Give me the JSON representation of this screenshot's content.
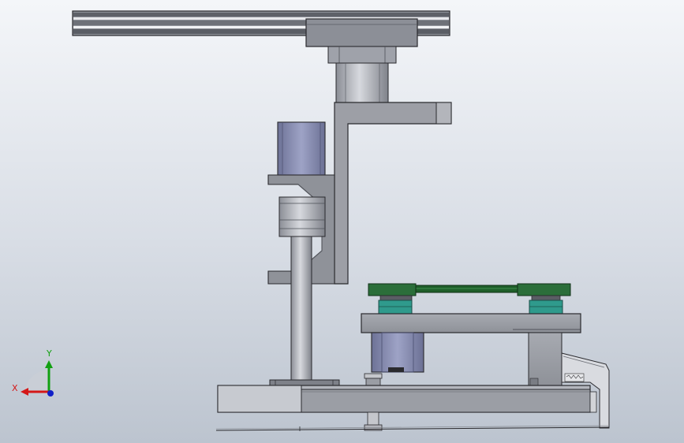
{
  "axis_triad": {
    "x_label": "X",
    "y_label": "Y",
    "x_color": "#d41818",
    "y_color": "#12a012",
    "z_color": "#1020c8"
  },
  "colors": {
    "metal_light": "#c8cad0",
    "metal_mid": "#9c9fa6",
    "metal_dark": "#6a6d74",
    "outline": "#2a2a2e",
    "motor": "#7f84a8",
    "belt": "#1f5f2a",
    "pulley_teal": "#2f9a8c"
  }
}
